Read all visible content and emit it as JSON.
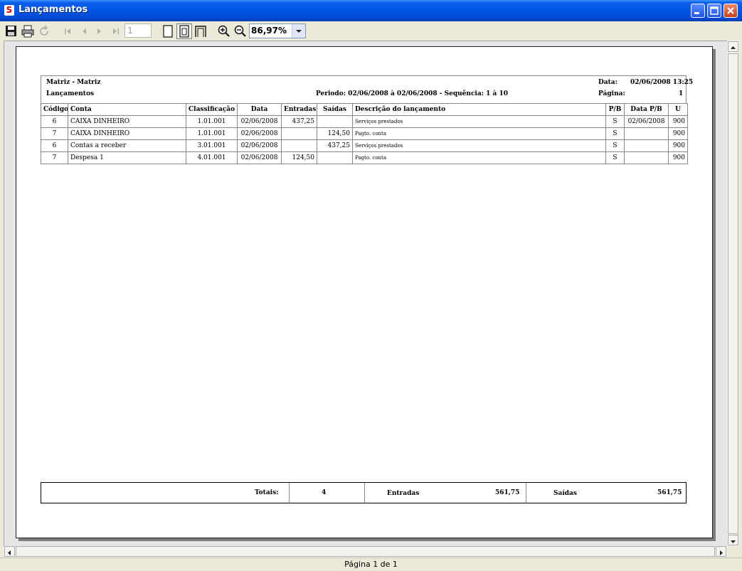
{
  "window": {
    "title": "Lançamentos"
  },
  "toolbar": {
    "page_input": "1",
    "zoom": "86,97%"
  },
  "report": {
    "company": "Matriz - Matriz",
    "subtitle": "Lançamentos",
    "date_label": "Data:",
    "date_value": "02/06/2008 13:25",
    "page_label": "Página:",
    "page_value": "1",
    "period_text": "Periodo: 02/06/2008 à 02/06/2008  -  Sequência: 1 à 10",
    "columns": [
      "Código",
      "Conta",
      "Classificação",
      "Data",
      "Entradas",
      "Saídas",
      "Descrição do lançamento",
      "P/B",
      "Data P/B",
      "U"
    ],
    "rows": [
      {
        "codigo": "6",
        "conta": "CAIXA DINHEIRO",
        "classificacao": "1.01.001",
        "data": "02/06/2008",
        "entradas": "437,25",
        "saidas": "",
        "descricao": "Serviços prestados",
        "pb": "S",
        "data_pb": "02/06/2008",
        "u": "900"
      },
      {
        "codigo": "7",
        "conta": "CAIXA DINHEIRO",
        "classificacao": "1.01.001",
        "data": "02/06/2008",
        "entradas": "",
        "saidas": "124,50",
        "descricao": "Pagto. conta",
        "pb": "S",
        "data_pb": "",
        "u": "900"
      },
      {
        "codigo": "6",
        "conta": "Contas a receber",
        "classificacao": "3.01.001",
        "data": "02/06/2008",
        "entradas": "",
        "saidas": "437,25",
        "descricao": "Serviços prestados",
        "pb": "S",
        "data_pb": "",
        "u": "900"
      },
      {
        "codigo": "7",
        "conta": "Despesa 1",
        "classificacao": "4.01.001",
        "data": "02/06/2008",
        "entradas": "124,50",
        "saidas": "",
        "descricao": "Pagto. conta",
        "pb": "S",
        "data_pb": "",
        "u": "900"
      }
    ],
    "totals": {
      "label": "Totais:",
      "count": "4",
      "entradas_label": "Entradas",
      "entradas_value": "561,75",
      "saidas_label": "Saídas",
      "saidas_value": "561,75"
    }
  },
  "status": {
    "text": "Página 1 de 1"
  }
}
